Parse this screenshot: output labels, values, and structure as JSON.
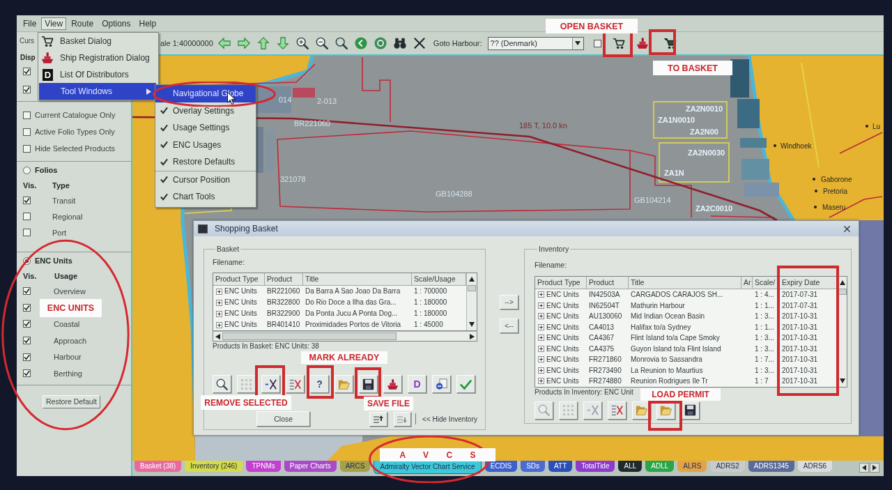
{
  "menu_bar": [
    {
      "label": "File",
      "selected": false
    },
    {
      "label": "View",
      "selected": true
    },
    {
      "label": "Route",
      "selected": false
    },
    {
      "label": "Options",
      "selected": false
    },
    {
      "label": "Help",
      "selected": false
    }
  ],
  "view_menu": {
    "items": [
      {
        "label": "Basket Dialog",
        "kind": "cart",
        "selected": false
      },
      {
        "label": "Ship Registration Dialog",
        "kind": "ship",
        "selected": false
      },
      {
        "label": "List Of Distributors",
        "kind": "glyph",
        "glyph": "D",
        "selected": false
      },
      {
        "label": "Tool Windows",
        "kind": "submenu",
        "selected": true
      }
    ],
    "submenu_groups": [
      [
        {
          "label": "Navigational Globe",
          "checked": false,
          "selected": true
        },
        {
          "label": "Overlay Settings",
          "checked": true,
          "selected": false
        },
        {
          "label": "Usage Settings",
          "checked": true,
          "selected": false
        },
        {
          "label": "ENC Usages",
          "checked": true,
          "selected": false
        },
        {
          "label": "Restore Defaults",
          "checked": true,
          "selected": false
        }
      ],
      [
        {
          "label": "Cursor Position",
          "checked": true,
          "selected": false
        },
        {
          "label": "Chart Tools",
          "checked": true,
          "selected": false
        }
      ]
    ]
  },
  "toolbar": {
    "scale": "ale 1:40000000",
    "tools": [
      {
        "kind": "arrow-left"
      },
      {
        "kind": "arrow-right"
      },
      {
        "kind": "arrow-up"
      },
      {
        "kind": "arrow-down"
      },
      {
        "kind": "zoom-in"
      },
      {
        "kind": "zoom-out"
      },
      {
        "kind": "magnifier"
      },
      {
        "kind": "circle-arrow"
      },
      {
        "kind": "ring"
      },
      {
        "kind": "binoculars"
      },
      {
        "kind": "cross"
      }
    ],
    "goto_label": "Goto Harbour:",
    "harbour": "?? (Denmark)",
    "filter_checked": false,
    "basket_tools": [
      {
        "kind": "cart"
      },
      {
        "kind": "ship"
      },
      {
        "kind": "cart-add"
      }
    ]
  },
  "left_panel": {
    "cursor_label": "Curs",
    "display_label": "Disp",
    "display_options": [
      {
        "checked": true
      },
      {
        "checked": true
      }
    ],
    "filter_options": [
      {
        "label": "Current Catalogue Only",
        "checked": false
      },
      {
        "label": "Active Folio Types Only",
        "checked": false
      },
      {
        "label": "Hide Selected Products",
        "checked": false
      }
    ],
    "folios": {
      "label": "Folios",
      "selected": false,
      "vis_header": "Vis.",
      "type_header": "Type",
      "types": [
        {
          "label": "Transit",
          "checked": true
        },
        {
          "label": "Regional",
          "checked": false
        },
        {
          "label": "Port",
          "checked": false
        }
      ]
    },
    "enc_units": {
      "label": "ENC Units",
      "selected": true,
      "vis_header": "Vis.",
      "usage_header": "Usage",
      "usages": [
        {
          "label": "Overview",
          "checked": true
        },
        {
          "checked": true
        },
        {
          "label": "Coastal",
          "checked": true
        },
        {
          "label": "Approach",
          "checked": true
        },
        {
          "label": "Harbour",
          "checked": true
        },
        {
          "label": "Berthing",
          "checked": true
        }
      ]
    },
    "restore_button": "Restore Default"
  },
  "map": {
    "cell_labels": [
      "014",
      "2-013",
      "BR221060",
      "321078",
      "GB104288",
      "GB104214",
      "ZA2N0010",
      "ZA1N0010",
      "ZA2N00",
      "ZA2N0030",
      "ZA1N",
      "ZA2C0010"
    ],
    "route_label": "185 T, 10.0 kn",
    "places": [
      "Windhoek",
      "Gaborone",
      "Pretoria",
      "Maseru",
      "Lu"
    ]
  },
  "basket_dialog": {
    "title": "Shopping Basket",
    "basket": {
      "legend": "Basket",
      "filename_label": "Filename:",
      "columns": [
        "Product Type",
        "Product",
        "Title",
        "Scale/Usage"
      ],
      "rows": [
        {
          "type": "ENC Units",
          "product": "BR221060",
          "title": "Da Barra A Sao Joao Da Barra",
          "scale": "1 : 700000"
        },
        {
          "type": "ENC Units",
          "product": "BR322800",
          "title": "Do Rio Doce a Ilha das Gra...",
          "scale": "1 : 180000"
        },
        {
          "type": "ENC Units",
          "product": "BR322900",
          "title": "Da Ponta Jucu A Ponta Dog...",
          "scale": "1 : 180000"
        },
        {
          "type": "ENC Units",
          "product": "BR401410",
          "title": "Proximidades Portos de Vitoria",
          "scale": "1 : 45000"
        }
      ],
      "status": "Products In Basket: ENC Units: 38",
      "tools": [
        {
          "kind": "search",
          "disabled": false
        },
        {
          "kind": "dots",
          "disabled": true
        },
        {
          "kind": "remove",
          "disabled": false
        },
        {
          "kind": "clear",
          "disabled": false
        },
        {
          "kind": "mark",
          "glyph": "?",
          "disabled": false
        },
        {
          "kind": "open",
          "disabled": false
        },
        {
          "kind": "save",
          "disabled": false
        },
        {
          "kind": "ship",
          "disabled": false
        },
        {
          "kind": "distributor",
          "glyph": "D",
          "disabled": false
        },
        {
          "kind": "export",
          "disabled": false
        },
        {
          "kind": "confirm",
          "disabled": false
        }
      ],
      "close_button": "Close",
      "hide_label": "<< Hide Inventory"
    },
    "transfer_buttons": [
      "-->",
      "<--"
    ],
    "inventory": {
      "legend": "Inventory",
      "filename_label": "Filename:",
      "columns": [
        "Product Type",
        "Product",
        "Title",
        "Ar",
        "Scale/",
        "Expiry Date"
      ],
      "rows": [
        {
          "type": "ENC Units",
          "product": "IN42503A",
          "title": "CARGADOS CARAJOS SH...",
          "scale": "1 : 4...",
          "expiry": "2017-07-31"
        },
        {
          "type": "ENC Units",
          "product": "IN62504T",
          "title": "Mathurin Harbour",
          "scale": "1 : 1...",
          "expiry": "2017-07-31"
        },
        {
          "type": "ENC Units",
          "product": "AU130060",
          "title": "Mid Indian Ocean Basin",
          "scale": "1 : 3...",
          "expiry": "2017-10-31"
        },
        {
          "type": "ENC Units",
          "product": "CA4013",
          "title": "Halifax to/a Sydney",
          "scale": "1 : 1...",
          "expiry": "2017-10-31"
        },
        {
          "type": "ENC Units",
          "product": "CA4367",
          "title": "Flint Island to/a Cape Smoky",
          "scale": "1 : 3...",
          "expiry": "2017-10-31"
        },
        {
          "type": "ENC Units",
          "product": "CA4375",
          "title": "Guyon Island to/a Flint Island",
          "scale": "1 : 3...",
          "expiry": "2017-10-31"
        },
        {
          "type": "ENC Units",
          "product": "FR271860",
          "title": "Monrovia to Sassandra",
          "scale": "1 : 7...",
          "expiry": "2017-10-31"
        },
        {
          "type": "ENC Units",
          "product": "FR273490",
          "title": "La Reunion to Maurtius",
          "scale": "1 : 3...",
          "expiry": "2017-10-31"
        },
        {
          "type": "ENC Units",
          "product": "FR274880",
          "title": "Reunion Rodrigues Ile Tr",
          "scale": "1 : 7",
          "expiry": "2017-10-31"
        }
      ],
      "status": "Products In Inventory: ENC Unit",
      "tools": [
        {
          "kind": "search",
          "disabled": true
        },
        {
          "kind": "dots",
          "disabled": true
        },
        {
          "kind": "remove",
          "disabled": true
        },
        {
          "kind": "clear",
          "disabled": false
        },
        {
          "kind": "open",
          "disabled": false
        },
        {
          "kind": "open",
          "disabled": false
        },
        {
          "kind": "save",
          "disabled": false
        }
      ]
    }
  },
  "tabs": [
    {
      "label": "Basket (38)",
      "color": "#e66a9e",
      "selected": false
    },
    {
      "label": "Inventory (246)",
      "color": "#d6dc48",
      "selected": false
    },
    {
      "label": "TPNMs",
      "color": "#c23fcf",
      "selected": false
    },
    {
      "label": "Paper Charts",
      "color": "#a94ac6",
      "selected": false
    },
    {
      "label": "ARCS",
      "color": "#a7a04a",
      "selected": false
    },
    {
      "label": "Admiralty Vector Chart Service",
      "color": "#3ccadb",
      "selected": true
    },
    {
      "label": "ECDIS",
      "color": "#3d5fca",
      "selected": false
    },
    {
      "label": "SDs",
      "color": "#4a6bd2",
      "selected": false
    },
    {
      "label": "ATT",
      "color": "#2a4fb9",
      "selected": false
    },
    {
      "label": "TotalTide",
      "color": "#8c3ccc",
      "selected": false
    },
    {
      "label": "ALL",
      "color": "#1f2a2c",
      "selected": false
    },
    {
      "label": "ADLL",
      "color": "#2aa64a",
      "selected": false
    },
    {
      "label": "ALRS",
      "color": "#e2a347",
      "selected": false
    },
    {
      "label": "ADRS2",
      "color": "#c9cbcb",
      "selected": false
    },
    {
      "label": "ADRS1345",
      "color": "#5a6a9c",
      "selected": false
    },
    {
      "label": "ADRS6",
      "color": "#dcdcdc",
      "selected": false
    }
  ],
  "annotations": [
    "OPEN BASKET",
    "TO BASKET",
    "ENC UNITS",
    "MARK ALREADY",
    "REMOVE SELECTED",
    "SAVE FILE",
    "LOAD PERMIT",
    "A V C S"
  ]
}
